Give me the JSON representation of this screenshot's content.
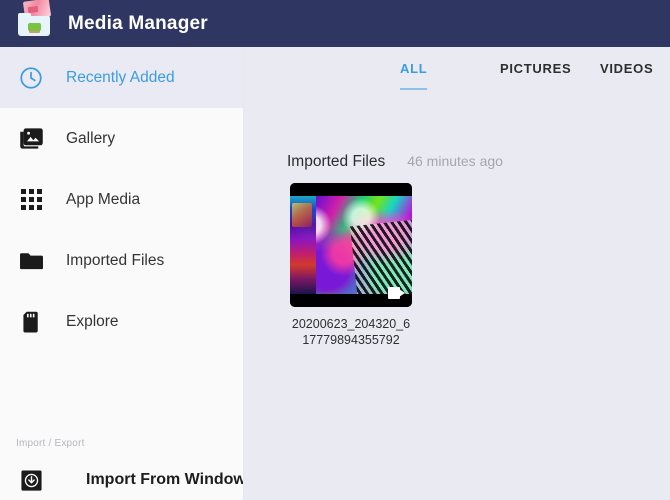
{
  "header": {
    "title": "Media Manager",
    "icon": "media-folder-icon",
    "background": "#2f3661",
    "title_color": "#ffffff"
  },
  "theme": {
    "accent_blue": "#3c9ce0",
    "underline_blue": "#8fc2e8",
    "sidebar_background": "#fafafa",
    "content_background": "#eaeaf2",
    "selected_row_background": "#e9eaf3"
  },
  "sidebar": {
    "items": [
      {
        "label": "Recently Added",
        "icon": "clock-icon",
        "selected": true
      },
      {
        "label": "Gallery",
        "icon": "photo-library-icon",
        "selected": false
      },
      {
        "label": "App Media",
        "icon": "grid-apps-icon",
        "selected": false
      },
      {
        "label": "Imported Files",
        "icon": "folder-icon",
        "selected": false
      },
      {
        "label": "Explore",
        "icon": "sd-card-icon",
        "selected": false
      }
    ],
    "section_label": "Import / Export",
    "import_item": {
      "label": "Import From Windows",
      "icon": "import-download-icon"
    }
  },
  "content": {
    "tabs": [
      {
        "label": "ALL",
        "active": true
      },
      {
        "label": "PICTURES",
        "active": false
      },
      {
        "label": "VIDEOS",
        "active": false
      }
    ],
    "group": {
      "title": "Imported Files",
      "timestamp": "46 minutes ago"
    },
    "items": [
      {
        "filename": "20200623_204320_617779894355792",
        "media_type": "video",
        "badge_icon": "video-camera-icon"
      }
    ]
  }
}
